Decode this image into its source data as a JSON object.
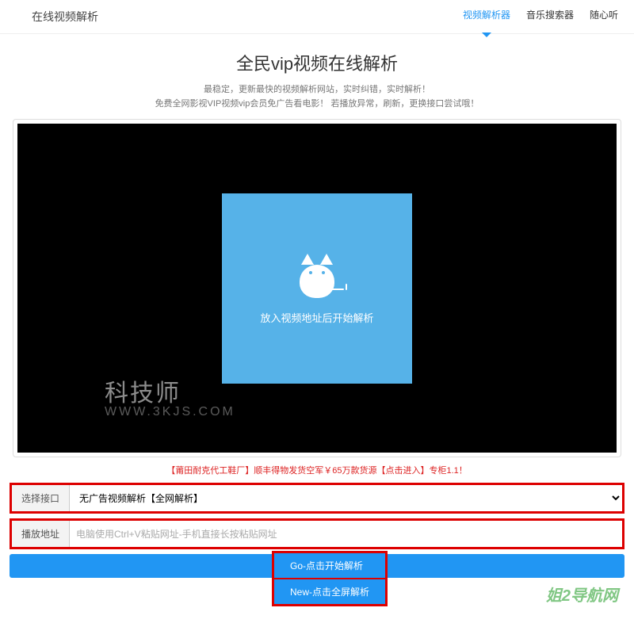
{
  "header": {
    "title": "在线视频解析",
    "nav": [
      {
        "label": "视频解析器",
        "active": true
      },
      {
        "label": "音乐搜索器",
        "active": false
      },
      {
        "label": "随心听",
        "active": false
      }
    ]
  },
  "main": {
    "title": "全民vip视频在线解析",
    "subtitle1": "最稳定，更新最快的视频解析网站，实时纠错，实时解析！",
    "subtitle2": "免费全网影视VIP视频vip会员免广告看电影！ 若播放异常，刷新，更换接口尝试哦！"
  },
  "player": {
    "placeholder_hint": "放入视频地址后开始解析",
    "watermark_main": "科技师",
    "watermark_sub": "WWW.3KJS.COM"
  },
  "ad": {
    "text": "【莆田耐克代工鞋厂】顺丰得物发货空军￥65万款货源【点击进入】专柜1.1！"
  },
  "form": {
    "api_label": "选择接口",
    "api_selected": "无广告视频解析【全网解析】",
    "url_label": "播放地址",
    "url_placeholder": "电脑使用Ctrl+V粘贴网址-手机直接长按粘贴网址"
  },
  "buttons": {
    "go": "Go-点击开始解析",
    "new": "New-点击全屏解析"
  },
  "footer": {
    "watermark": "姐2导航网"
  }
}
